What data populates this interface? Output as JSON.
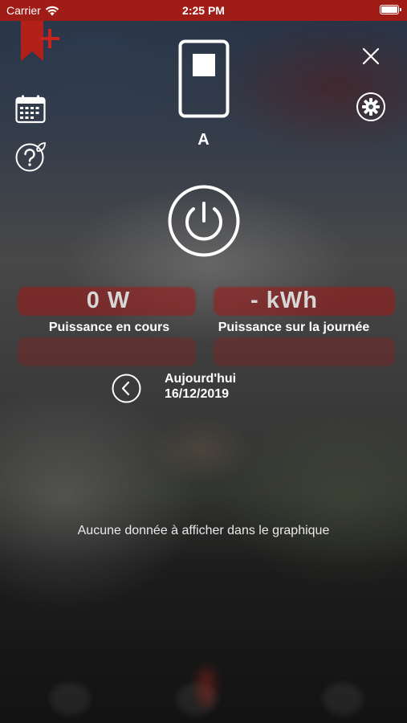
{
  "status_bar": {
    "carrier": "Carrier",
    "time": "2:25 PM",
    "battery_level": 1.0
  },
  "colors": {
    "brand_red": "#a01c16",
    "text_white": "#ffffff",
    "value_grey": "#d6d6d6"
  },
  "icons": {
    "bookmark": "bookmark-add-icon",
    "calendar": "calendar-icon",
    "help": "help-leaf-icon",
    "close": "close-icon",
    "settings": "gear-icon",
    "device": "switch-device-icon",
    "power": "power-icon",
    "previous": "chevron-left-icon"
  },
  "device": {
    "name": "A"
  },
  "metrics": {
    "current_power": {
      "value": "0 W",
      "label": "Puissance en cours"
    },
    "daily_power": {
      "value": "- kWh",
      "label": "Puissance sur la journée"
    }
  },
  "date_nav": {
    "label": "Aujourd'hui",
    "date": "16/12/2019"
  },
  "chart": {
    "empty_message": "Aucune donnée à afficher dans le graphique"
  }
}
